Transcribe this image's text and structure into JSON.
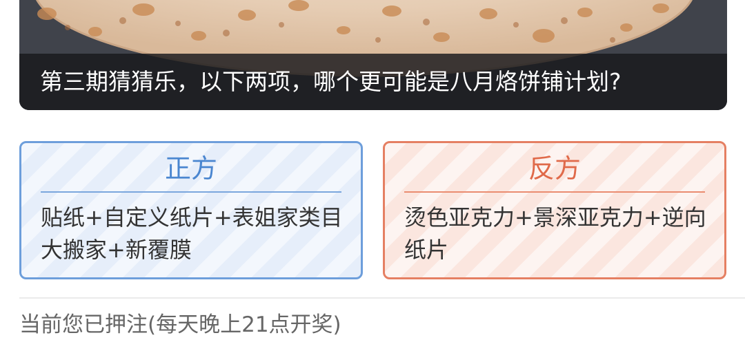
{
  "banner": {
    "caption": "第三期猜猜乐，以下两项，哪个更可能是八月烙饼铺计划?"
  },
  "options": {
    "pro": {
      "title": "正方",
      "text": "贴纸+自定义纸片+表姐家类目大搬家+新覆膜"
    },
    "con": {
      "title": "反方",
      "text": "烫色亚克力+景深亚克力+逆向纸片"
    }
  },
  "footer": {
    "status": "当前您已押注(每天晚上21点开奖)"
  },
  "colors": {
    "pro_accent": "#4a86d0",
    "con_accent": "#e06a4a"
  }
}
